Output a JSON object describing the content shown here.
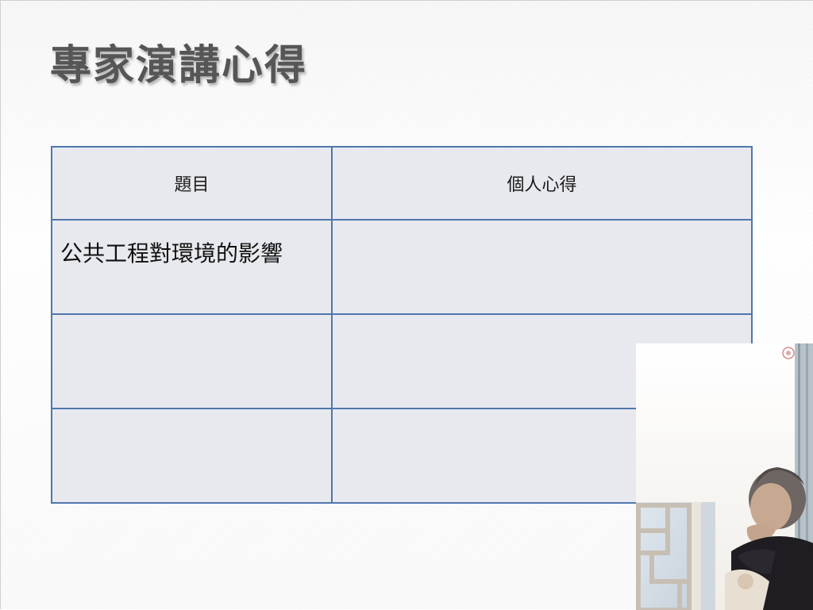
{
  "slide": {
    "title": "專家演講心得"
  },
  "table": {
    "headers": [
      "題目",
      "個人心得"
    ],
    "rows": [
      [
        "公共工程對環境的影響",
        ""
      ],
      [
        "",
        ""
      ],
      [
        "",
        ""
      ]
    ]
  },
  "colors": {
    "title": "#565656",
    "table_border": "#4f76ad",
    "cell_background": "#e8e9ee"
  }
}
